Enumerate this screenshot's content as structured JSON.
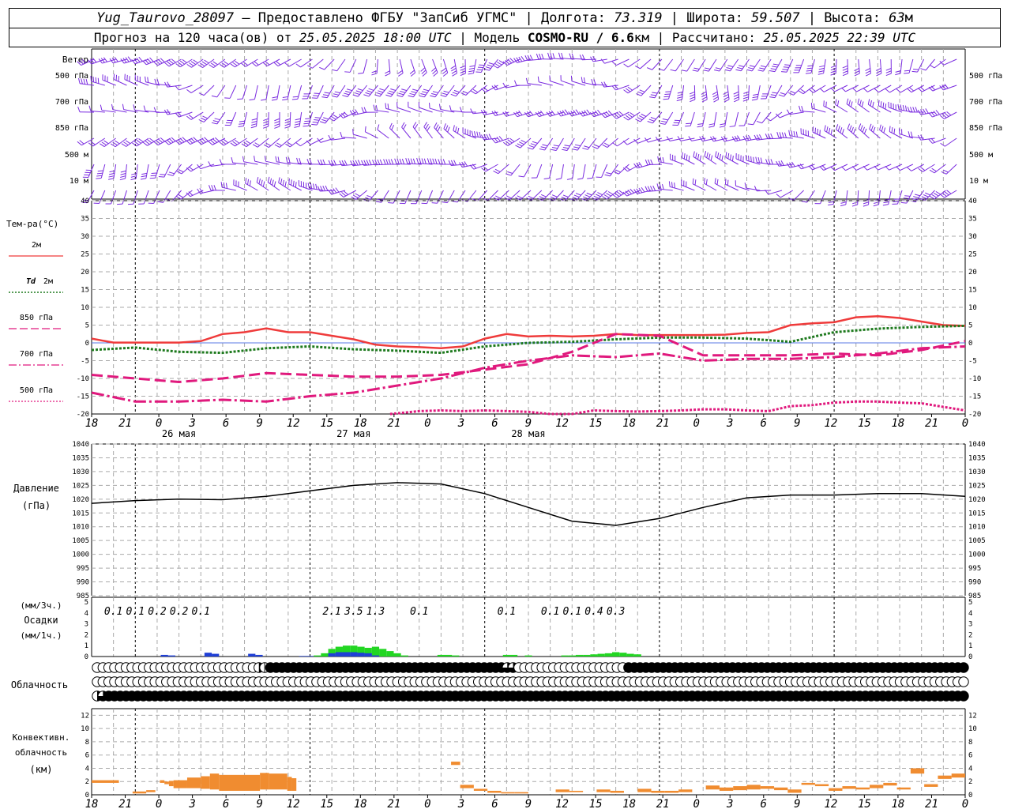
{
  "header": {
    "station": "Yug_Taurovo_28097",
    "provider": " – Предоставлено ФГБУ \"ЗапСиб УГМС\" | Долгота: ",
    "lon": "73.319",
    "lat_label": " | Широта: ",
    "lat": "59.507",
    "alt_label": " | Высота: ",
    "alt": "63",
    "alt_unit": "м",
    "forecast_prefix": "Прогноз на 120 часа(ов) от ",
    "forecast_time": "25.05.2025 18:00 UTC",
    "model_label": " | Модель ",
    "model": "COSMO-RU / 6.6",
    "model_unit": "км",
    "calc_label": " | Рассчитано: ",
    "calc_time": "25.05.2025 22:39 UTC"
  },
  "colors": {
    "wind": "#7a2be0",
    "t2m": "#ef3b3b",
    "td2m": "#1e7a1e",
    "t850": "#e0197d",
    "t700": "#e0197d",
    "t500": "#e0197d",
    "pressure": "#000000",
    "precip_blue": "#1f3fd6",
    "precip_green": "#22d622",
    "convective": "#f08c30",
    "grid": "#aaaaaa"
  },
  "wind_panel": {
    "title": "Ветер",
    "levels": [
      "500 гПа",
      "700 гПа",
      "850 гПа",
      "500 м",
      "10  м"
    ],
    "right_levels": [
      "500 гПа",
      "700 гПа",
      "850 гПа",
      "500 м",
      "10  м"
    ]
  },
  "temp_panel": {
    "title": "Тем-ра(°С)",
    "legend": [
      {
        "label": "2м",
        "style": "solid"
      },
      {
        "label_italic": "Td",
        "label": "2м",
        "style": "dotted"
      },
      {
        "label": "850 гПа",
        "style": "dashed"
      },
      {
        "label": "700 гПа",
        "style": "dashdot"
      },
      {
        "label": "500 гПа",
        "style": "fine"
      }
    ],
    "ticks": [
      -20,
      -15,
      -10,
      -5,
      0,
      5,
      10,
      15,
      20,
      25,
      30,
      35,
      40
    ]
  },
  "time_axis": {
    "labels": [
      "18",
      "21",
      "0",
      "3",
      "6",
      "9",
      "12",
      "15",
      "18",
      "21",
      "0",
      "3",
      "6",
      "9",
      "12",
      "15",
      "18",
      "21",
      "0",
      "3",
      "6",
      "9",
      "12",
      "15",
      "18",
      "21",
      "0"
    ],
    "days": [
      "26 мая",
      "27 мая",
      "28 мая"
    ]
  },
  "pressure_panel": {
    "title": "Давление",
    "unit": "(гПа)",
    "ticks": [
      985,
      990,
      995,
      1000,
      1005,
      1010,
      1015,
      1020,
      1025,
      1030,
      1035,
      1040
    ]
  },
  "precip_panel": {
    "unit3": "(мм/3ч.)",
    "title": "Осадки",
    "unit1": "(мм/1ч.)",
    "ticks": [
      0,
      1,
      2,
      3,
      4,
      5
    ],
    "totals": [
      {
        "x": 3,
        "v": "0.1"
      },
      {
        "x": 6,
        "v": "0.1"
      },
      {
        "x": 9,
        "v": "0.2"
      },
      {
        "x": 12,
        "v": "0.2"
      },
      {
        "x": 15,
        "v": "0.1"
      },
      {
        "x": 33,
        "v": "2.1"
      },
      {
        "x": 36,
        "v": "3.5"
      },
      {
        "x": 39,
        "v": "1.3"
      },
      {
        "x": 45,
        "v": "0.1"
      },
      {
        "x": 57,
        "v": "0.1"
      },
      {
        "x": 63,
        "v": "0.1"
      },
      {
        "x": 66,
        "v": "0.1"
      },
      {
        "x": 69,
        "v": "0.4"
      },
      {
        "x": 72,
        "v": "0.3"
      }
    ]
  },
  "cloud_panel": {
    "title": "Облачность",
    "rows": [
      "OOOOOOOOOOOOOOOOOOOOOOOOOOOOHIFFFFFFFFFFFFFFFFFFFFFFFFFFFFFFFFFFFFFFFFFQQOOOOOOOOOOOOOOOOOOOFFFFFFFFFFFFFFFFFFFFFFFFFFFFFFFFFFFFFFFFFFFFFFFFFFFFFFFFFFF",
      "OOOOOOOOOOOOOOOOOOOOOOOOOOOOOOOOOOOOOOOOOOOOOOOOOOOOOOOOOOOOOOOOOOOOOOOOOOOOOOOOOOOOOOOOOOOOOOOOOOOOOOOOOOOOOOOOOOOOOOOOOOOOOOOOOOOOOOOOOOOOOOOOOOOOOOO",
      "HQFFFFFFFFFFFFFFFFFFFFFFFFFFFFFFFFFFFFFFFFFFFFFFFFFFFFFFFFFFFFFFFFFFFFFFFFFFFFFFFFFFFFFFFFFFFFFFFFFFFFFFFFFFFFFFFFFFFFFFFFFFFFFFFFFFFFFFFFFFFFFFFFFFFFF"
    ]
  },
  "conv_panel": {
    "title1": "Конвективн.",
    "title2": "облачность",
    "unit": "(км)",
    "ticks": [
      0,
      2,
      4,
      6,
      8,
      10,
      12
    ]
  },
  "chart_data": [
    {
      "type": "line",
      "panel": "temperature",
      "x_unit": "hours from 25.05.2025 18:00 UTC",
      "ylim": [
        -20,
        40
      ],
      "series": [
        {
          "name": "2м",
          "x": [
            0,
            3,
            6,
            9,
            12,
            15,
            18,
            21,
            24,
            27,
            30,
            33,
            36,
            39,
            42,
            45,
            48,
            51,
            54,
            57,
            60,
            63,
            66,
            69,
            72,
            75,
            78,
            81,
            84,
            87,
            90,
            93,
            96,
            99,
            102,
            105,
            108,
            111,
            114,
            117,
            120
          ],
          "values": [
            1.2,
            0.1,
            0.1,
            0.1,
            0.1,
            0.5,
            2.5,
            3.0,
            4.1,
            3.0,
            3.0,
            2.0,
            1.0,
            -0.5,
            -1.0,
            -1.2,
            -1.5,
            -1.0,
            1.2,
            2.5,
            1.8,
            2.0,
            1.8,
            2.0,
            2.5,
            2.2,
            2.2,
            2.2,
            2.2,
            2.3,
            2.8,
            3.0,
            5.0,
            5.5,
            5.8,
            7.2,
            7.5,
            7.0,
            6.0,
            5.0,
            4.8
          ]
        },
        {
          "name": "Td 2м",
          "x": [
            0,
            6,
            12,
            18,
            24,
            30,
            36,
            42,
            48,
            54,
            60,
            66,
            72,
            78,
            84,
            90,
            96,
            102,
            108,
            114,
            120
          ],
          "values": [
            -2.0,
            -1.3,
            -2.5,
            -2.8,
            -1.5,
            -1.0,
            -1.8,
            -2.2,
            -2.8,
            -1.0,
            0.0,
            0.3,
            1.0,
            1.5,
            1.5,
            1.2,
            0.3,
            3.0,
            4.0,
            4.5,
            4.8
          ]
        },
        {
          "name": "850 гПа",
          "x": [
            0,
            6,
            12,
            18,
            24,
            30,
            36,
            42,
            48,
            54,
            60,
            66,
            72,
            78,
            84,
            90,
            96,
            102,
            108,
            114,
            120
          ],
          "values": [
            -9.0,
            -10.0,
            -11.0,
            -10.0,
            -8.5,
            -9.0,
            -9.5,
            -9.5,
            -9.0,
            -7.5,
            -6.0,
            -2.5,
            2.5,
            2.0,
            -3.5,
            -3.5,
            -3.5,
            -3.0,
            -3.5,
            -2.0,
            0.5
          ]
        },
        {
          "name": "700 гПа",
          "x": [
            0,
            6,
            12,
            18,
            24,
            30,
            36,
            42,
            48,
            54,
            60,
            66,
            72,
            78,
            84,
            90,
            96,
            102,
            108,
            114,
            120
          ],
          "values": [
            -14.0,
            -16.5,
            -16.5,
            -16.0,
            -16.5,
            -15.0,
            -14.0,
            -12.0,
            -10.0,
            -7.0,
            -5.0,
            -3.5,
            -4.0,
            -3.0,
            -5.0,
            -4.5,
            -4.5,
            -4.0,
            -3.0,
            -1.5,
            -1.0
          ]
        },
        {
          "name": "500 гПа",
          "x": [
            41,
            45,
            48,
            51,
            54,
            57,
            60,
            63,
            66,
            69,
            72,
            75,
            78,
            81,
            84,
            87,
            90,
            93,
            96,
            99,
            102,
            105,
            108,
            111,
            114,
            117,
            120
          ],
          "values": [
            -20.0,
            -19.2,
            -19.0,
            -19.2,
            -19.0,
            -19.2,
            -19.4,
            -20.0,
            -20.0,
            -19.0,
            -19.2,
            -19.3,
            -19.2,
            -19.0,
            -18.7,
            -18.7,
            -19.0,
            -19.2,
            -17.8,
            -17.5,
            -16.8,
            -16.5,
            -16.5,
            -16.8,
            -17.0,
            -18.0,
            -19.0
          ]
        }
      ]
    },
    {
      "type": "line",
      "panel": "pressure",
      "x_unit": "hours from 25.05.2025 18:00 UTC",
      "ylim": [
        985,
        1040
      ],
      "series": [
        {
          "name": "Давление",
          "x": [
            0,
            6,
            12,
            18,
            24,
            30,
            36,
            42,
            48,
            54,
            60,
            66,
            72,
            78,
            84,
            90,
            96,
            102,
            108,
            114,
            120
          ],
          "values": [
            1018.5,
            1019.5,
            1020.0,
            1019.8,
            1021.0,
            1023.0,
            1025.0,
            1026.0,
            1025.5,
            1022.0,
            1017.0,
            1012.0,
            1010.5,
            1013.0,
            1017.0,
            1020.5,
            1021.5,
            1021.5,
            1022.0,
            1022.0,
            1021.0
          ]
        }
      ]
    },
    {
      "type": "bar",
      "panel": "precipitation",
      "unit": "мм/1ч",
      "x_unit": "hours from 25.05.2025 18:00 UTC",
      "ylim": [
        0,
        5
      ],
      "series": [
        {
          "name": "blue",
          "x": [
            10,
            11,
            16,
            17,
            22,
            23,
            29,
            30,
            33,
            34,
            35,
            36,
            37,
            38,
            39
          ],
          "values": [
            0.15,
            0.1,
            0.35,
            0.25,
            0.25,
            0.15,
            0.05,
            0.05,
            0.3,
            0.4,
            0.4,
            0.4,
            0.35,
            0.3,
            0.1
          ]
        },
        {
          "name": "green",
          "x": [
            31,
            32,
            33,
            34,
            35,
            36,
            37,
            38,
            39,
            40,
            41,
            42,
            43,
            48,
            49,
            50,
            57,
            58,
            60,
            65,
            66,
            67,
            68,
            69,
            70,
            71,
            72,
            73,
            74,
            75
          ],
          "values": [
            0.1,
            0.3,
            0.7,
            0.9,
            1.0,
            1.0,
            0.9,
            0.8,
            0.9,
            0.7,
            0.5,
            0.3,
            0.1,
            0.15,
            0.15,
            0.1,
            0.15,
            0.15,
            0.1,
            0.1,
            0.1,
            0.15,
            0.15,
            0.2,
            0.25,
            0.3,
            0.4,
            0.35,
            0.25,
            0.2
          ]
        }
      ]
    },
    {
      "type": "bar",
      "panel": "convective",
      "unit": "км",
      "x_unit": "hours from 25.05.2025 18:00 UTC",
      "ylim": [
        0,
        13
      ],
      "bars": [
        {
          "x0": 0,
          "x1": 6,
          "lo": 1.8,
          "hi": 2.2
        },
        {
          "x0": 9,
          "x1": 12,
          "lo": 0.2,
          "hi": 0.5
        },
        {
          "x0": 12,
          "x1": 14,
          "lo": 0.4,
          "hi": 0.7
        },
        {
          "x0": 15,
          "x1": 16,
          "lo": 1.8,
          "hi": 2.2
        },
        {
          "x0": 16,
          "x1": 17,
          "lo": 1.6,
          "hi": 2.0
        },
        {
          "x0": 17,
          "x1": 18,
          "lo": 1.3,
          "hi": 2.1
        },
        {
          "x0": 18,
          "x1": 21,
          "lo": 1.0,
          "hi": 2.2
        },
        {
          "x0": 21,
          "x1": 24,
          "lo": 1.0,
          "hi": 2.6
        },
        {
          "x0": 24,
          "x1": 26,
          "lo": 0.9,
          "hi": 2.8
        },
        {
          "x0": 26,
          "x1": 28,
          "lo": 0.8,
          "hi": 3.2
        },
        {
          "x0": 28,
          "x1": 37,
          "lo": 0.6,
          "hi": 3.0
        },
        {
          "x0": 37,
          "x1": 39,
          "lo": 0.8,
          "hi": 3.3
        },
        {
          "x0": 39,
          "x1": 43,
          "lo": 0.8,
          "hi": 3.2
        },
        {
          "x0": 43,
          "x1": 44,
          "lo": 0.6,
          "hi": 2.7
        },
        {
          "x0": 44,
          "x1": 45,
          "lo": 0.6,
          "hi": 2.5
        },
        {
          "x0": 79,
          "x1": 81,
          "lo": 4.5,
          "hi": 5.0
        },
        {
          "x0": 81,
          "x1": 84,
          "lo": 1.0,
          "hi": 1.5
        },
        {
          "x0": 84,
          "x1": 87,
          "lo": 0.6,
          "hi": 0.9
        },
        {
          "x0": 87,
          "x1": 90,
          "lo": 0.3,
          "hi": 0.6
        },
        {
          "x0": 90,
          "x1": 93,
          "lo": 0.2,
          "hi": 0.4
        },
        {
          "x0": 93,
          "x1": 96,
          "lo": 0.2,
          "hi": 0.4
        },
        {
          "x0": 102,
          "x1": 105,
          "lo": 0.4,
          "hi": 0.8
        },
        {
          "x0": 105,
          "x1": 108,
          "lo": 0.4,
          "hi": 0.6
        },
        {
          "x0": 111,
          "x1": 114,
          "lo": 0.4,
          "hi": 0.8
        },
        {
          "x0": 114,
          "x1": 117,
          "lo": 0.3,
          "hi": 0.6
        },
        {
          "x0": 120,
          "x1": 123,
          "lo": 0.4,
          "hi": 0.9
        },
        {
          "x0": 123,
          "x1": 126,
          "lo": 0.3,
          "hi": 0.6
        },
        {
          "x0": 126,
          "x1": 129,
          "lo": 0.3,
          "hi": 0.6
        },
        {
          "x0": 129,
          "x1": 132,
          "lo": 0.4,
          "hi": 0.8
        },
        {
          "x0": 135,
          "x1": 138,
          "lo": 0.8,
          "hi": 1.4
        },
        {
          "x0": 138,
          "x1": 141,
          "lo": 0.6,
          "hi": 1.1
        },
        {
          "x0": 141,
          "x1": 144,
          "lo": 0.7,
          "hi": 1.3
        },
        {
          "x0": 144,
          "x1": 147,
          "lo": 0.8,
          "hi": 1.5
        },
        {
          "x0": 147,
          "x1": 150,
          "lo": 0.9,
          "hi": 1.3
        },
        {
          "x0": 150,
          "x1": 153,
          "lo": 0.7,
          "hi": 1.1
        },
        {
          "x0": 153,
          "x1": 156,
          "lo": 0.3,
          "hi": 0.8
        },
        {
          "x0": 156,
          "x1": 159,
          "lo": 1.5,
          "hi": 1.8
        },
        {
          "x0": 159,
          "x1": 162,
          "lo": 1.3,
          "hi": 1.6
        },
        {
          "x0": 162,
          "x1": 165,
          "lo": 0.6,
          "hi": 1.0
        },
        {
          "x0": 165,
          "x1": 168,
          "lo": 0.9,
          "hi": 1.3
        },
        {
          "x0": 168,
          "x1": 171,
          "lo": 0.8,
          "hi": 1.1
        },
        {
          "x0": 171,
          "x1": 174,
          "lo": 1.0,
          "hi": 1.5
        },
        {
          "x0": 174,
          "x1": 177,
          "lo": 1.4,
          "hi": 1.8
        },
        {
          "x0": 177,
          "x1": 180,
          "lo": 0.8,
          "hi": 1.1
        },
        {
          "x0": 180,
          "x1": 183,
          "lo": 3.2,
          "hi": 4.0
        },
        {
          "x0": 183,
          "x1": 186,
          "lo": 1.2,
          "hi": 1.6
        },
        {
          "x0": 186,
          "x1": 189,
          "lo": 2.4,
          "hi": 2.9
        },
        {
          "x0": 189,
          "x1": 192,
          "lo": 2.6,
          "hi": 3.2
        }
      ]
    }
  ]
}
